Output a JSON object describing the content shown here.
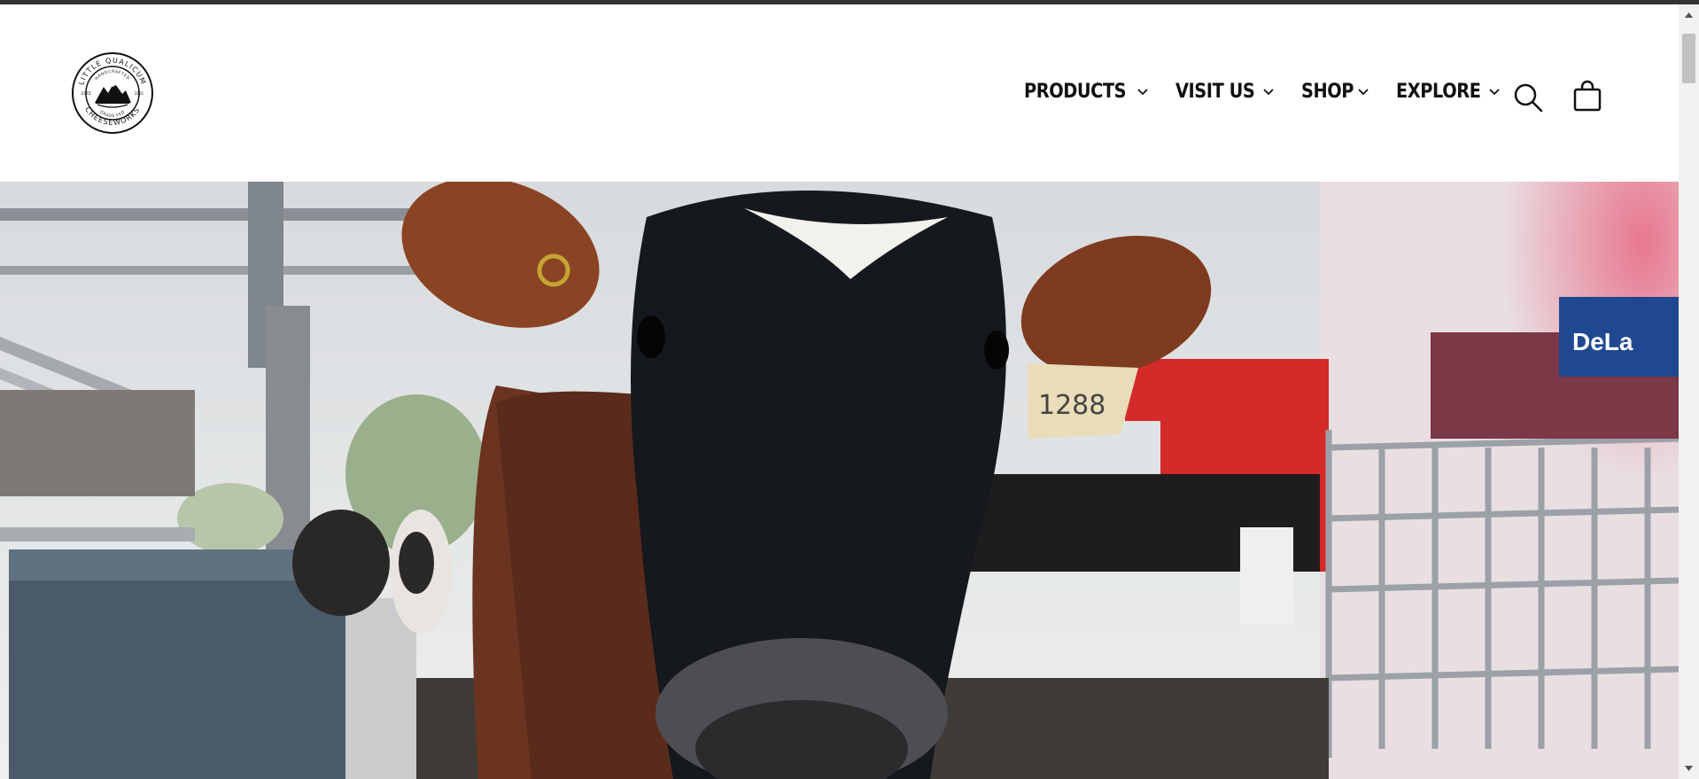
{
  "brand": {
    "logo_top_text": "LITTLE QUALICUM",
    "logo_bottom_text": "CHEESEWORKS",
    "logo_inner_top": "HANDCRAFTED",
    "logo_inner_bottom": "GRASS FED",
    "logo_left": "ESTD",
    "logo_right": "2001"
  },
  "nav": {
    "items": [
      {
        "label": "PRODUCTS"
      },
      {
        "label": "VISIT US"
      },
      {
        "label": "SHOP"
      },
      {
        "label": "EXPLORE"
      }
    ]
  },
  "hero": {
    "ear_tag": "1288",
    "sign_text": "DeLa"
  },
  "icons": {
    "search": "search-icon",
    "cart": "cart-icon"
  }
}
